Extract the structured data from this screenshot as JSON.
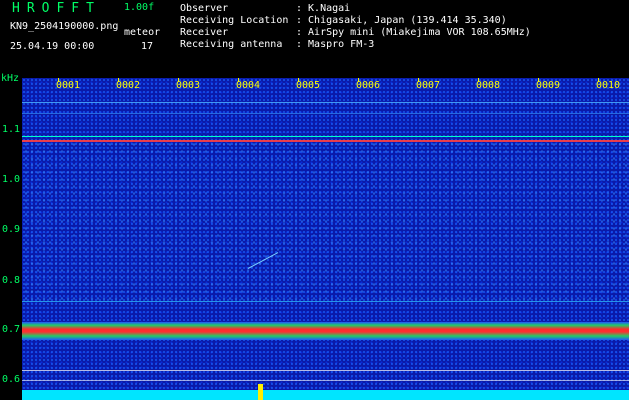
{
  "header": {
    "app_title": "HROFFT",
    "version": "1.00f",
    "filename": "KN9_2504190000.png",
    "meteor_label": "meteor",
    "datetime": "25.04.19 00:00",
    "meteor_count": "17"
  },
  "metadata": [
    {
      "label": "Observer",
      "value": ": K.Nagai"
    },
    {
      "label": "Receiving Location",
      "value": ": Chigasaki, Japan (139.414 35.340)"
    },
    {
      "label": "Receiver",
      "value": ": AirSpy mini (Miakejima VOR 108.65MHz)"
    },
    {
      "label": "Receiving antenna",
      "value": ": Maspro FM-3"
    }
  ],
  "y_axis": {
    "unit": "kHz",
    "ticks": [
      "1.1",
      "1.0",
      "0.9",
      "0.8",
      "0.7",
      "0.6"
    ]
  },
  "x_axis": {
    "ticks": [
      "0001",
      "0002",
      "0003",
      "0004",
      "0005",
      "0006",
      "0007",
      "0008",
      "0009",
      "0010"
    ]
  },
  "colors": {
    "label_green": "#00ff66",
    "tick_yellow": "#ffff00",
    "plot_background": "#0a1aa8",
    "echo_red": "#ff2a2a",
    "baseline_cyan": "#00e5ff"
  }
}
